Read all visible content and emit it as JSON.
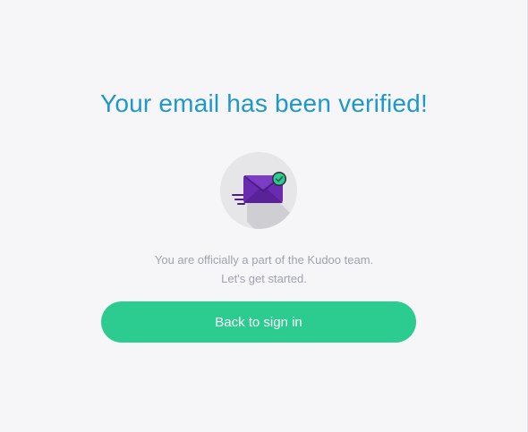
{
  "heading": "Your email has been verified!",
  "message": {
    "line1": "You are officially a part of the Kudoo team.",
    "line2": "Let's get started."
  },
  "actions": {
    "back_to_sign_in": "Back to sign in"
  },
  "icons": {
    "badge": "envelope-verified-icon",
    "check": "check-circle-icon"
  },
  "colors": {
    "heading": "#1f97c9",
    "button": "#2ccb8f",
    "envelope": "#6a2bb0",
    "check": "#2ccb8f"
  }
}
